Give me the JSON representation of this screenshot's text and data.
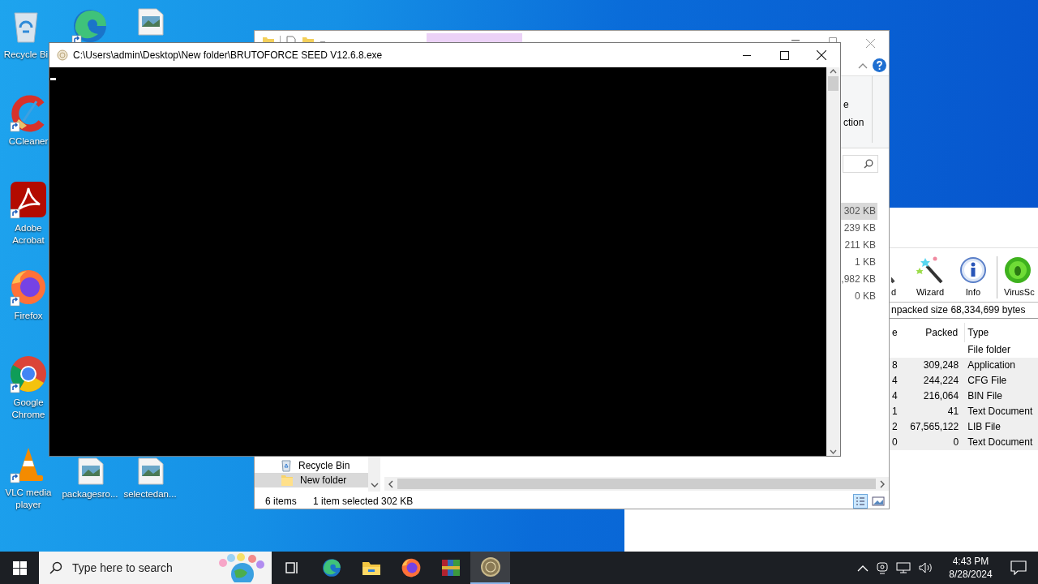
{
  "desktop": {
    "icons": [
      {
        "kind": "recycle",
        "label": "Recycle Bi",
        "shortcut": false
      },
      {
        "kind": "edge",
        "shortcut": true
      },
      {
        "kind": "image",
        "shortcut": false
      },
      {
        "kind": "ccleaner",
        "label": "CCleaner",
        "shortcut": true
      },
      {
        "kind": "acrobat",
        "label": "Adobe Acrobat",
        "shortcut": true
      },
      {
        "kind": "firefox",
        "label": "Firefox",
        "shortcut": true
      },
      {
        "kind": "chrome",
        "label": "Google Chrome",
        "shortcut": true
      },
      {
        "kind": "vlc",
        "label": "VLC media player",
        "shortcut": true
      },
      {
        "kind": "image",
        "label": "packagesro...",
        "shortcut": false
      },
      {
        "kind": "image",
        "label": "selectedan...",
        "shortcut": false
      }
    ]
  },
  "winrar": {
    "tools": [
      {
        "kind": "find",
        "label": "d"
      },
      {
        "kind": "wizard",
        "label": "Wizard"
      },
      {
        "kind": "info",
        "label": "Info"
      },
      {
        "kind": "virus",
        "label": "VirusSc"
      }
    ],
    "summary": "npacked size 68,334,699 bytes",
    "columns": [
      "e",
      "Packed",
      "Type"
    ],
    "rows": [
      {
        "type": "File folder",
        "selected": false
      },
      {
        "size": "8",
        "packed": "309,248",
        "type": "Application",
        "selected": true
      },
      {
        "size": "4",
        "packed": "244,224",
        "type": "CFG File",
        "selected": true
      },
      {
        "size": "4",
        "packed": "216,064",
        "type": "BIN File",
        "selected": true
      },
      {
        "size": "1",
        "packed": "41",
        "type": "Text Document",
        "selected": true
      },
      {
        "size": "2",
        "packed": "67,565,122",
        "type": "LIB File",
        "selected": true
      },
      {
        "size": "0",
        "packed": "0",
        "type": "Text Document",
        "selected": true
      }
    ]
  },
  "explorer": {
    "ribbon_fragments": [
      "e",
      "ction"
    ],
    "file_sizes": [
      {
        "size": "302 KB",
        "selected": true
      },
      {
        "size": "239 KB",
        "selected": false
      },
      {
        "size": "211 KB",
        "selected": false
      },
      {
        "size": "1 KB",
        "selected": false
      },
      {
        "size": ",982 KB",
        "selected": false
      },
      {
        "size": "0 KB",
        "selected": false
      }
    ],
    "nav_items": [
      {
        "kind": "recycle",
        "label": "Recycle Bin",
        "selected": false
      },
      {
        "kind": "folder",
        "label": "New folder",
        "selected": true
      }
    ],
    "status_bar": {
      "items": "6 items",
      "selection": "1 item selected",
      "size": "302 KB"
    }
  },
  "console": {
    "title": "C:\\Users\\admin\\Desktop\\New folder\\BRUTOFORCE SEED V12.6.8.exe"
  },
  "taskbar": {
    "search_placeholder": "Type here to search",
    "apps": [
      {
        "kind": "taskview",
        "selected": false
      },
      {
        "kind": "edge",
        "selected": false
      },
      {
        "kind": "explorer",
        "selected": false
      },
      {
        "kind": "firefox",
        "selected": false
      },
      {
        "kind": "winrar",
        "selected": false
      },
      {
        "kind": "console",
        "selected": true
      }
    ],
    "time": "4:43 PM",
    "date": "8/28/2024"
  }
}
